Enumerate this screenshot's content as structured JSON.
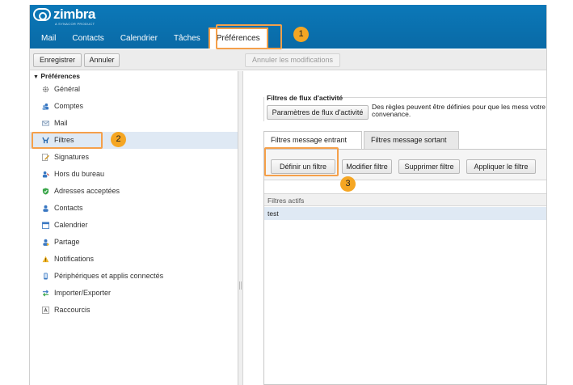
{
  "app": {
    "logo_text": "zimbra",
    "logo_subtext": "A SYNACOR PRODUCT",
    "accent_color": "#0b78b8",
    "highlight_color": "#f5a04a"
  },
  "nav": {
    "tabs": [
      {
        "label": "Mail"
      },
      {
        "label": "Contacts"
      },
      {
        "label": "Calendrier"
      },
      {
        "label": "Tâches"
      },
      {
        "label": "Préférences",
        "active": true
      }
    ]
  },
  "toolbar": {
    "save_label": "Enregistrer",
    "cancel_label": "Annuler",
    "undo_label": "Annuler les modifications"
  },
  "sidebar": {
    "title": "Préférences",
    "items": [
      {
        "label": "Général",
        "icon": "gear-icon"
      },
      {
        "label": "Comptes",
        "icon": "accounts-icon"
      },
      {
        "label": "Mail",
        "icon": "mail-icon"
      },
      {
        "label": "Filtres",
        "icon": "filter-icon",
        "selected": true
      },
      {
        "label": "Signatures",
        "icon": "signature-icon"
      },
      {
        "label": "Hors du bureau",
        "icon": "out-of-office-icon"
      },
      {
        "label": "Adresses acceptées",
        "icon": "shield-check-icon"
      },
      {
        "label": "Contacts",
        "icon": "contact-icon"
      },
      {
        "label": "Calendrier",
        "icon": "calendar-icon"
      },
      {
        "label": "Partage",
        "icon": "sharing-icon"
      },
      {
        "label": "Notifications",
        "icon": "bell-icon"
      },
      {
        "label": "Périphériques et applis connectés",
        "icon": "device-icon"
      },
      {
        "label": "Importer/Exporter",
        "icon": "import-export-icon"
      },
      {
        "label": "Raccourcis",
        "icon": "keyboard-icon"
      }
    ]
  },
  "main": {
    "section_title": "Filtres de flux d'activité",
    "flux_button": "Paramètres de flux d'activité",
    "flux_description": "Des règles peuvent être définies pour que les mess votre convenance.",
    "subtabs": [
      {
        "label": "Filtres message entrant",
        "active": true
      },
      {
        "label": "Filtres message sortant"
      }
    ],
    "actions": {
      "define": "Définir un filtre",
      "modify": "Modifier filtre",
      "delete": "Supprimer filtre",
      "apply": "Appliquer le filtre"
    },
    "list_header": "Filtres actifs",
    "filters": [
      {
        "name": "test"
      }
    ]
  },
  "callouts": [
    {
      "number": "1"
    },
    {
      "number": "2"
    },
    {
      "number": "3"
    }
  ]
}
